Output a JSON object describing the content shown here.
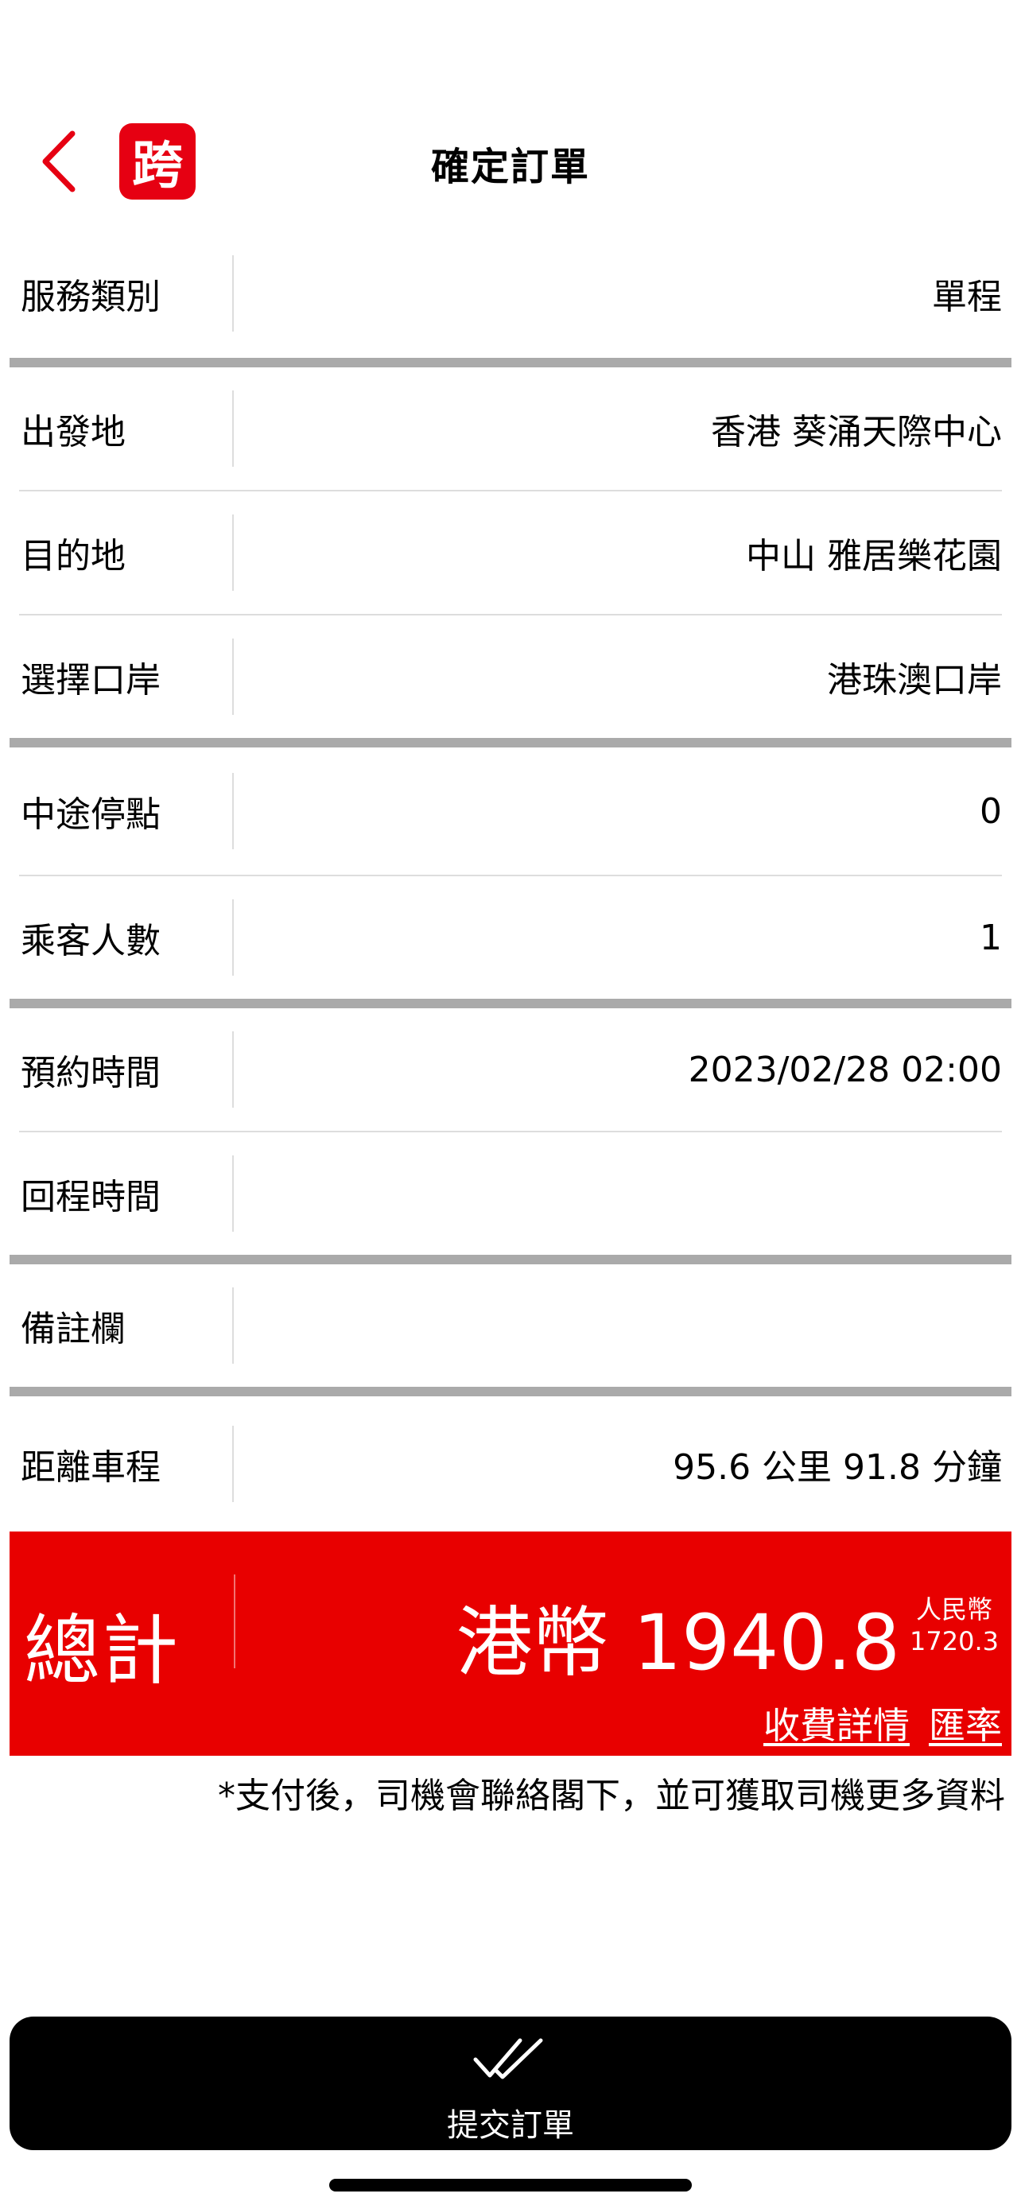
{
  "header": {
    "title": "確定訂單",
    "logo_text": "跨",
    "back_icon": "chevron-left-icon"
  },
  "colors": {
    "accent": "#e60012",
    "total_bg": "#e80000",
    "divider_thick": "#aaaaaa",
    "divider_thin": "#dddddd"
  },
  "fields": {
    "service_type": {
      "label": "服務類別",
      "value": "單程"
    },
    "departure": {
      "label": "出發地",
      "value": "香港 葵涌天際中心"
    },
    "destination": {
      "label": "目的地",
      "value": "中山 雅居樂花園"
    },
    "port": {
      "label": "選擇口岸",
      "value": "港珠澳口岸"
    },
    "stops": {
      "label": "中途停點",
      "value": "0"
    },
    "passengers": {
      "label": "乘客人數",
      "value": "1"
    },
    "booking_time": {
      "label": "預約時間",
      "value": "2023/02/28 02:00"
    },
    "return_time": {
      "label": "回程時間",
      "value": ""
    },
    "remarks": {
      "label": "備註欄",
      "value": ""
    },
    "distance": {
      "label": "距離車程",
      "value": "95.6 公里 91.8 分鐘"
    }
  },
  "total": {
    "label": "總計",
    "amount": "港幣 1940.8",
    "rmb_label": "人民幣",
    "rmb_value": "1720.3",
    "fee_details_link": "收費詳情",
    "exchange_rate_link": "匯率"
  },
  "note": "*支付後，司機會聯絡閣下，並可獲取司機更多資料",
  "submit": {
    "label": "提交訂單",
    "icon": "double-check-icon"
  }
}
